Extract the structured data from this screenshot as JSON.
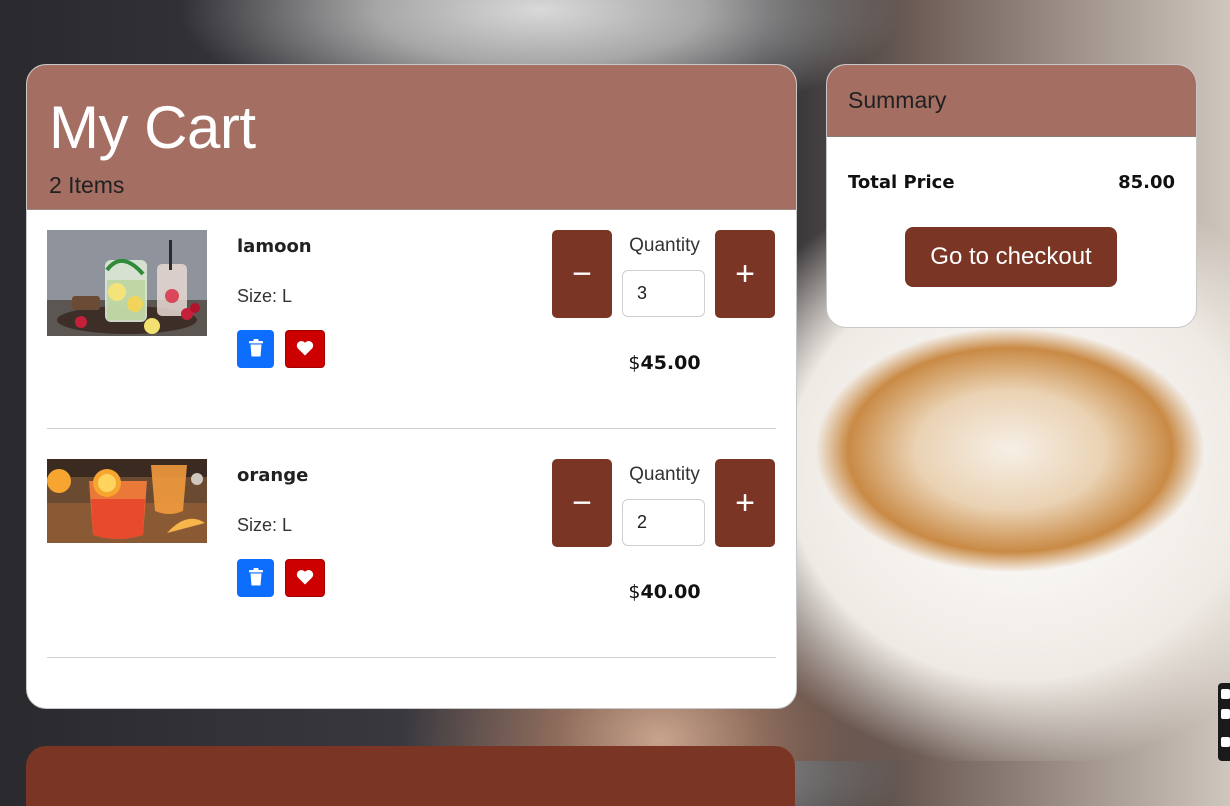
{
  "cart": {
    "title": "My Cart",
    "count": "2 Items"
  },
  "items": [
    {
      "name": "lamoon",
      "size": "Size: L",
      "quantity_label": "Quantity",
      "quantity": "3",
      "minus_label": "−",
      "plus_label": "+",
      "currency": "$",
      "price": "45.00"
    },
    {
      "name": "orange",
      "size": "Size: L",
      "quantity_label": "Quantity",
      "quantity": "2",
      "minus_label": "−",
      "plus_label": "+",
      "currency": "$",
      "price": "40.00"
    }
  ],
  "summary": {
    "title": "Summary",
    "total_label": "Total Price",
    "total_value": "85.00",
    "checkout_label": "Go to checkout"
  },
  "colors": {
    "header": "#a46e63",
    "primary_button": "#7b3524",
    "trash_button": "#0d6efd",
    "heart_button": "#cc0000"
  }
}
